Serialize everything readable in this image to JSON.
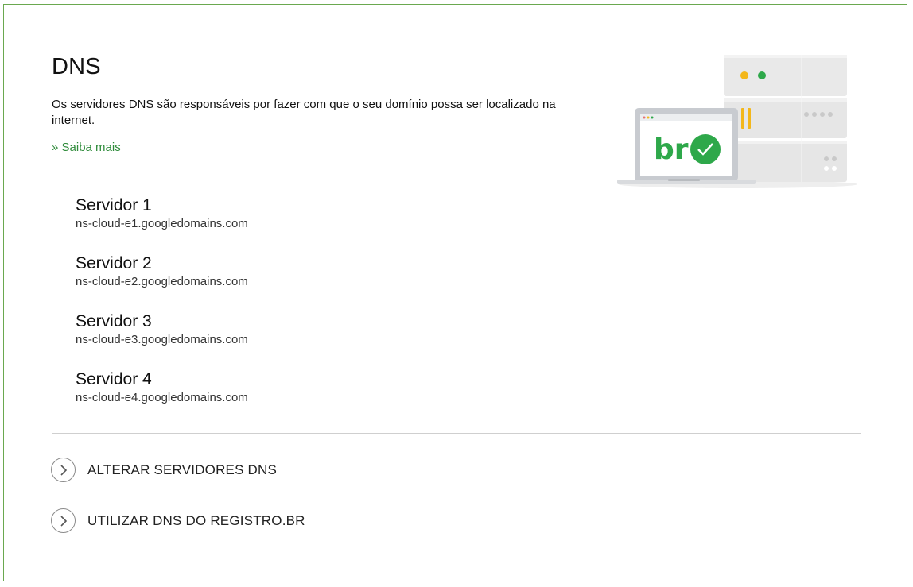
{
  "dns": {
    "title": "DNS",
    "description": "Os servidores DNS são responsáveis por fazer com que o seu domínio possa ser localizado na internet.",
    "learn_more": "» Saiba mais",
    "illustration_label": "br",
    "servers": [
      {
        "name": "Servidor 1",
        "host": "ns-cloud-e1.googledomains.com"
      },
      {
        "name": "Servidor 2",
        "host": "ns-cloud-e2.googledomains.com"
      },
      {
        "name": "Servidor 3",
        "host": "ns-cloud-e3.googledomains.com"
      },
      {
        "name": "Servidor 4",
        "host": "ns-cloud-e4.googledomains.com"
      }
    ],
    "actions": [
      {
        "label": "ALTERAR SERVIDORES DNS",
        "icon": "chevron-right-icon"
      },
      {
        "label": "UTILIZAR DNS DO REGISTRO.BR",
        "icon": "chevron-right-icon"
      }
    ]
  },
  "colors": {
    "border": "#6aa84f",
    "link": "#2e8b3a",
    "accent_green": "#2ea84a",
    "accent_yellow": "#f3b71b"
  }
}
